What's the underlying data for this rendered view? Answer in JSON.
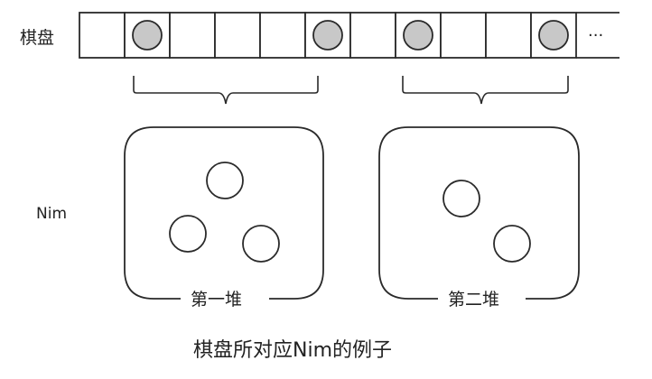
{
  "board": {
    "label": "棋盘",
    "cell_count": 11,
    "stone_cells": [
      1,
      5,
      7,
      10
    ],
    "ellipsis": "···"
  },
  "nim": {
    "label": "Nim",
    "piles": [
      {
        "label": "第一堆",
        "stones": 3
      },
      {
        "label": "第二堆",
        "stones": 2
      }
    ]
  },
  "caption": "棋盘所对应Nim的例子",
  "colors": {
    "line": "#2a2a2a",
    "stone_fill": "#c8c8c8",
    "background": "#ffffff"
  }
}
